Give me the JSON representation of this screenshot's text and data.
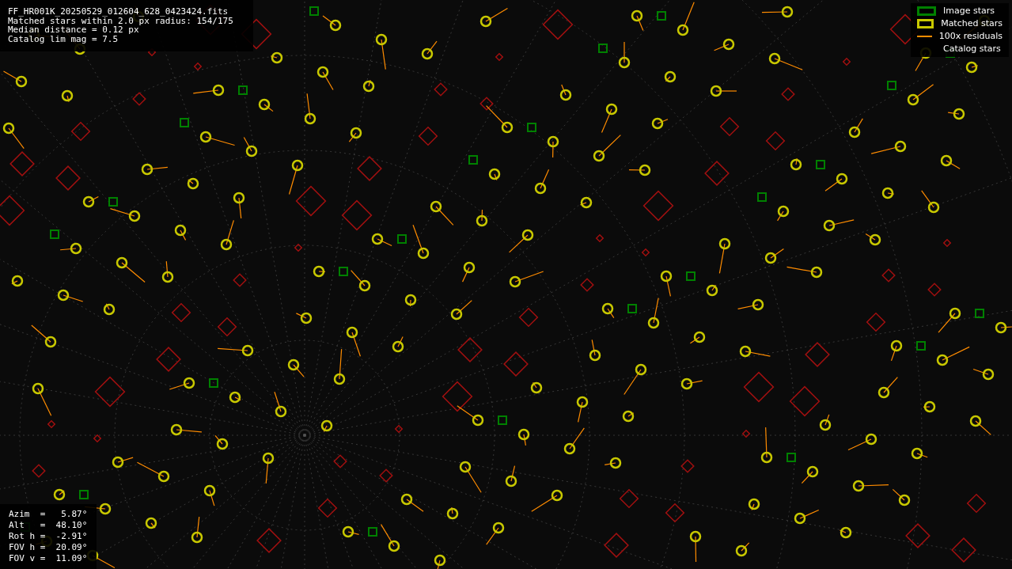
{
  "info_lines": [
    "FF_HR001K_20250529_012604_628_0423424.fits",
    "Matched stars within 2.0 px radius: 154/175",
    "Median distance = 0.12 px",
    "Catalog lim mag = 7.5"
  ],
  "legend": [
    {
      "kind": "box",
      "color": "#008000",
      "label": "Image stars"
    },
    {
      "kind": "box",
      "color": "#c8c800",
      "label": "Matched stars"
    },
    {
      "kind": "line",
      "color": "#ff8c00",
      "label": "100x residuals"
    },
    {
      "kind": "blank",
      "label": "Catalog stars"
    }
  ],
  "pointing_lines": [
    "Azim  =   5.87°",
    "Alt   =  48.10°",
    "Rot h =  -2.91°",
    "FOV h =  20.09°",
    "FOV v =  11.09°"
  ]
}
